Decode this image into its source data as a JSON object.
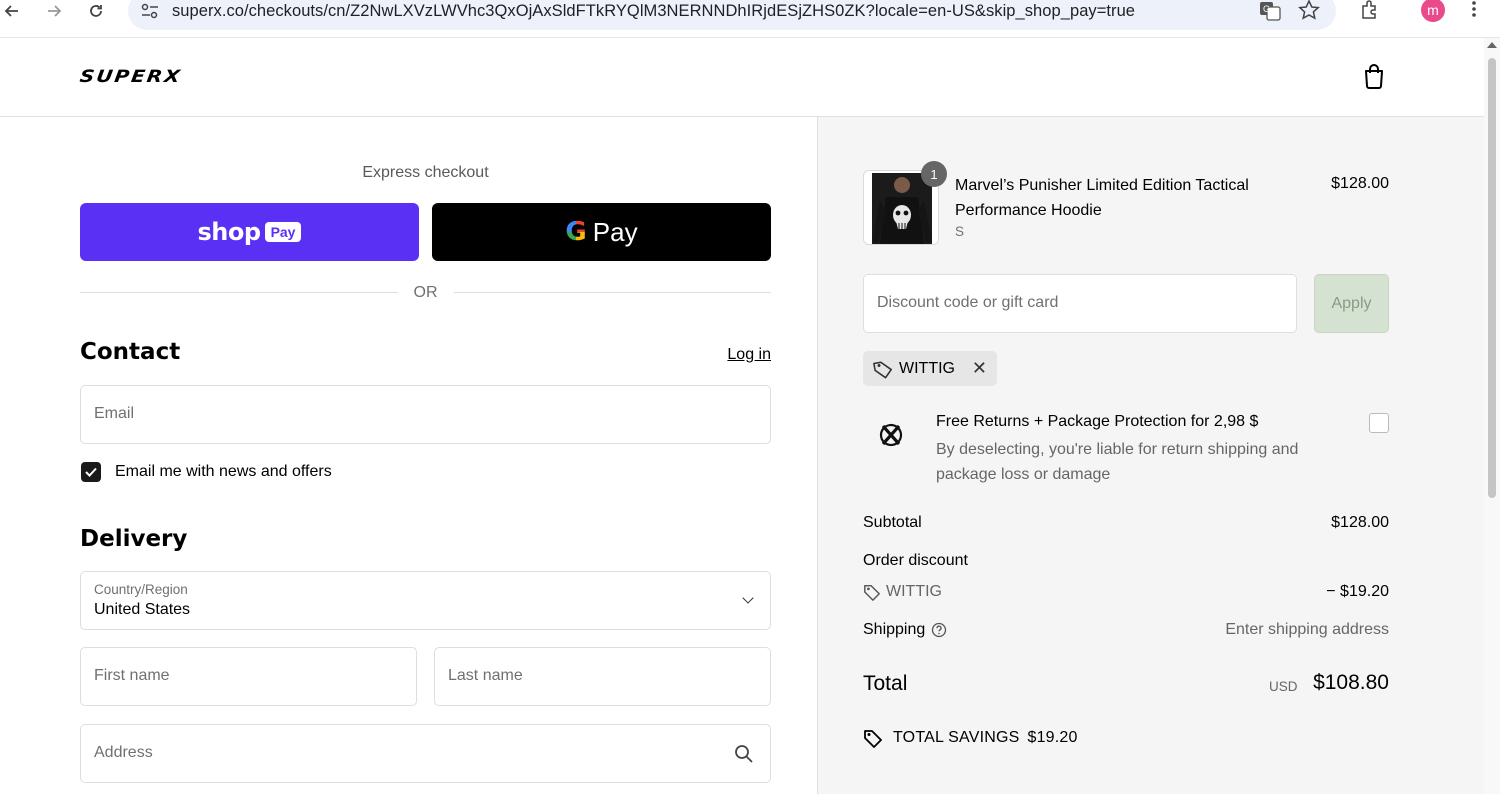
{
  "browser": {
    "url": "superx.co/checkouts/cn/Z2NwLXVzLWVhc3QxOjAxSldFTkRYQlM3NERNNDhIRjdESjZHS0ZK?locale=en-US&skip_shop_pay=true",
    "back_icon": "arrow-left-icon",
    "forward_icon": "arrow-right-icon",
    "reload_icon": "reload-icon",
    "avatar_letter": "m"
  },
  "header": {
    "logo": "SUPERX",
    "cart_icon": "shopping-bag-icon"
  },
  "express": {
    "label": "Express checkout",
    "shop_pay_word": "shop",
    "shop_pay_badge": "Pay",
    "gpay_g": "G",
    "gpay_text": "Pay",
    "or": "OR"
  },
  "contact": {
    "title": "Contact",
    "login": "Log in",
    "email_placeholder": "Email",
    "newsletter_label": "Email me with news and offers",
    "newsletter_checked": true
  },
  "delivery": {
    "title": "Delivery",
    "country_label": "Country/Region",
    "country_value": "United States",
    "first_name_placeholder": "First name",
    "last_name_placeholder": "Last name",
    "address_placeholder": "Address"
  },
  "order": {
    "quantity": "1",
    "product_name": "Marvel’s Punisher Limited Edition Tactical Performance Hoodie",
    "variant": "S",
    "product_price": "$128.00",
    "discount_placeholder": "Discount code or gift card",
    "apply_label": "Apply",
    "applied_code": "WITTIG",
    "protection_title": "Free Returns + Package Protection for 2,98 $",
    "protection_desc": "By deselecting, you're liable for return shipping and package loss or damage",
    "subtotal_label": "Subtotal",
    "subtotal_value": "$128.00",
    "discount_label": "Order discount",
    "discount_code": "WITTIG",
    "discount_value": "− $19.20",
    "shipping_label": "Shipping",
    "shipping_value": "Enter shipping address",
    "total_label": "Total",
    "total_currency": "USD",
    "total_value": "$108.80",
    "savings_label": "TOTAL SAVINGS",
    "savings_value": "$19.20"
  },
  "colors": {
    "shop_pay": "#5a31f4",
    "gpay": "#000000",
    "apply_bg": "#d6e2d1",
    "summary_bg": "#f5f5f5"
  }
}
